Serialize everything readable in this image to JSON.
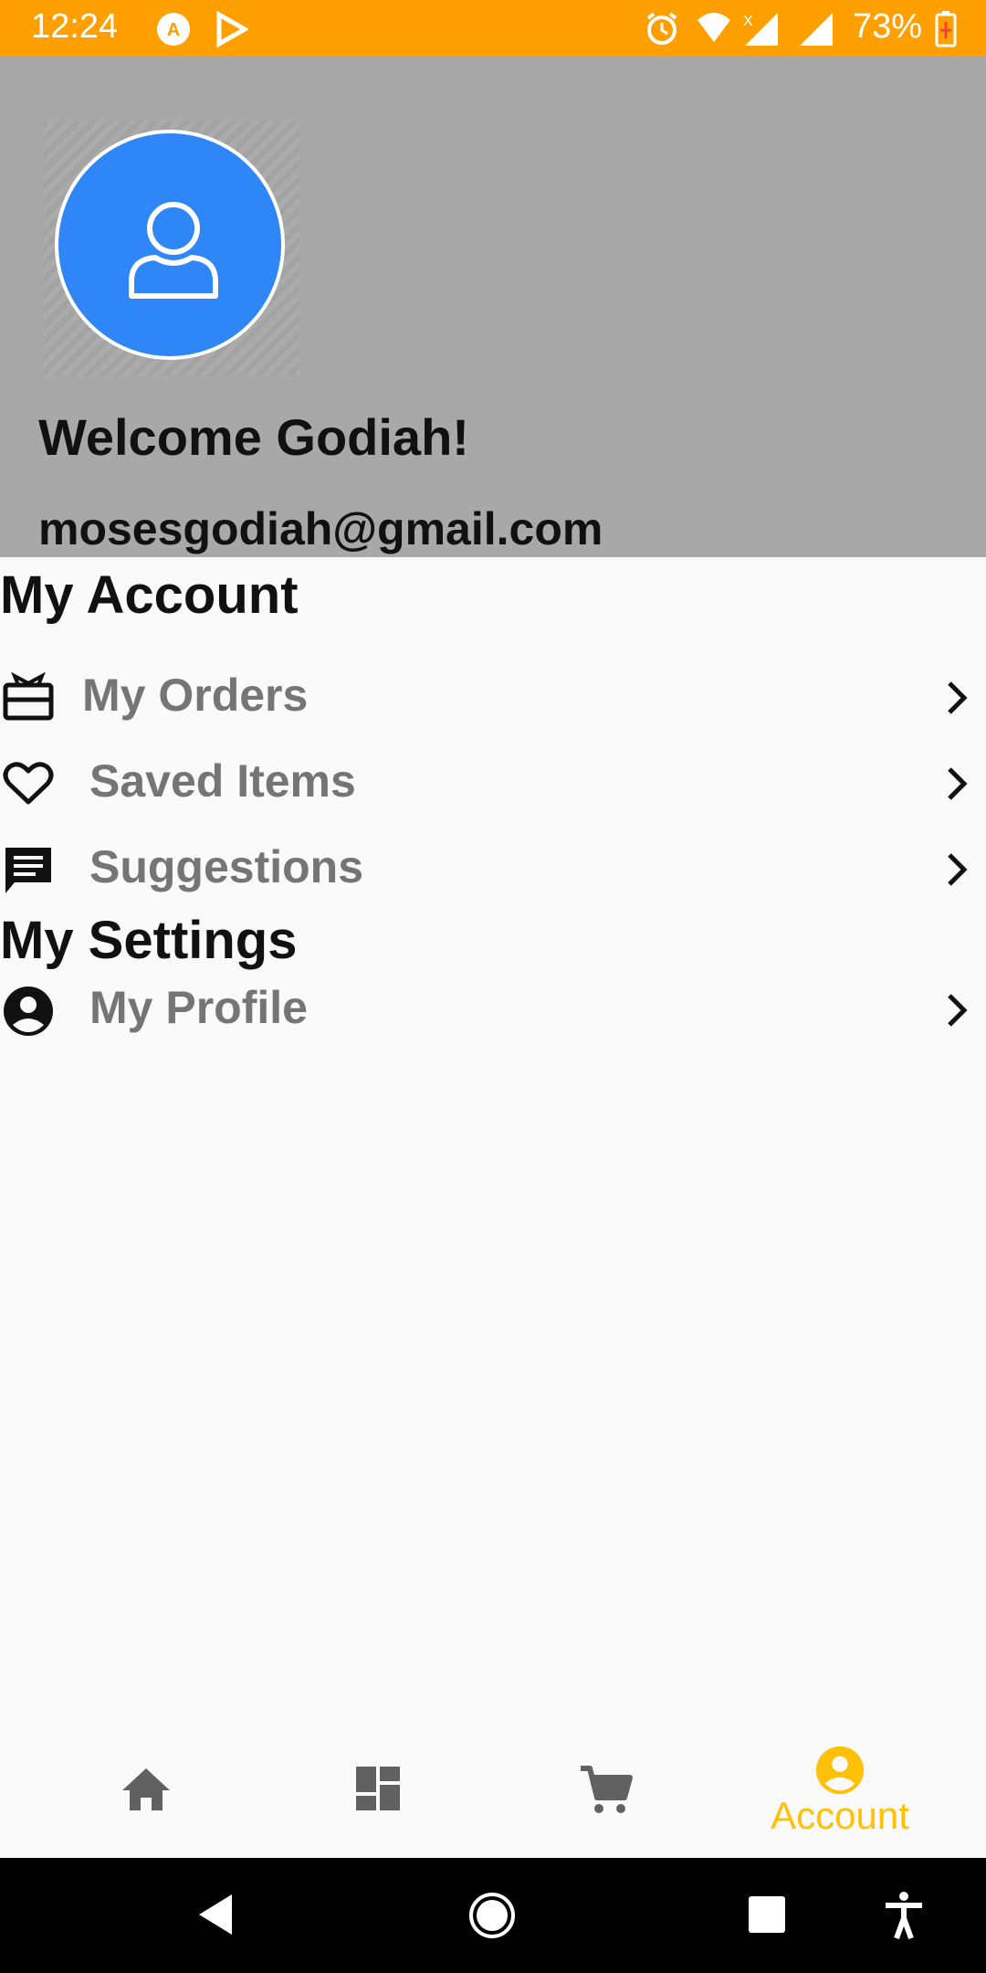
{
  "status_bar": {
    "time": "12:24",
    "battery": "73%",
    "icons": [
      "app-notification-icon",
      "play-store-icon",
      "alarm-icon",
      "wifi-icon",
      "signal-icon",
      "signal-icon",
      "battery-charging-icon"
    ]
  },
  "header": {
    "welcome": "Welcome Godiah!",
    "email": "mosesgodiah@gmail.com",
    "avatar_icon": "person-icon"
  },
  "account_section": {
    "title": "My Account",
    "items": [
      {
        "label": "My Orders",
        "icon": "orders-box-icon"
      },
      {
        "label": "Saved Items",
        "icon": "heart-icon"
      },
      {
        "label": "Suggestions",
        "icon": "chat-icon"
      }
    ]
  },
  "settings_section": {
    "title": "My Settings",
    "items": [
      {
        "label": "My Profile",
        "icon": "account-circle-icon"
      }
    ]
  },
  "bottom_nav": {
    "items": [
      {
        "icon": "home-icon",
        "label": ""
      },
      {
        "icon": "dashboard-icon",
        "label": ""
      },
      {
        "icon": "cart-icon",
        "label": ""
      },
      {
        "icon": "account-circle-icon",
        "label": "Account",
        "active": true
      }
    ],
    "active_color": "#ffc107",
    "inactive_color": "#616161"
  },
  "colors": {
    "status_bar": "#ffa000",
    "header_bg": "#a8a8a8",
    "avatar": "#2f86f6",
    "label_gray": "#757575"
  }
}
